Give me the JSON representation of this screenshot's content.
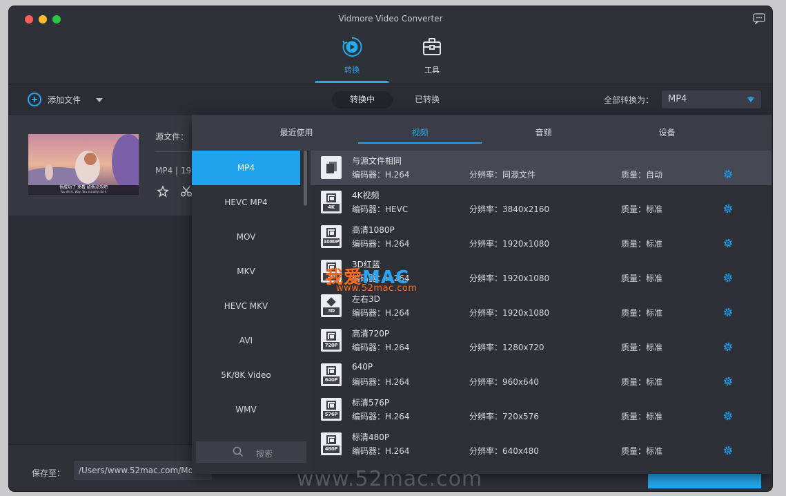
{
  "window": {
    "title": "Vidmore Video Converter"
  },
  "nav": {
    "convert_label": "转换",
    "tools_label": "工具"
  },
  "toolbar": {
    "add_file_label": "添加文件",
    "segment_converting": "转换中",
    "segment_converted": "已转换",
    "convert_all_label": "全部转换为：",
    "convert_all_value": "MP4"
  },
  "file": {
    "source_label": "源文件：",
    "meta_text": "MP4 | 19",
    "subtitle_line1": "他成功了 来看 给他点乐吧",
    "subtitle_line2": "You did it. Way. You actually did it"
  },
  "bottom": {
    "save_label": "保存至：",
    "save_path": "/Users/www.52mac.com/Mo"
  },
  "popup": {
    "tabs": [
      {
        "label": "最近使用",
        "active": false
      },
      {
        "label": "视频",
        "active": true
      },
      {
        "label": "音频",
        "active": false
      },
      {
        "label": "设备",
        "active": false
      }
    ],
    "formats": [
      {
        "label": "MP4",
        "active": true
      },
      {
        "label": "HEVC MP4",
        "active": false
      },
      {
        "label": "MOV",
        "active": false
      },
      {
        "label": "MKV",
        "active": false
      },
      {
        "label": "HEVC MKV",
        "active": false
      },
      {
        "label": "AVI",
        "active": false
      },
      {
        "label": "5K/8K Video",
        "active": false
      },
      {
        "label": "WMV",
        "active": false
      }
    ],
    "search_placeholder": "搜索",
    "presets": [
      {
        "name": "与源文件相同",
        "encoder": "编码器：H.264",
        "resolution": "分辨率：同源文件",
        "quality": "质量：自动",
        "icon": "same",
        "tag": "",
        "active": true
      },
      {
        "name": "4K视频",
        "encoder": "编码器：HEVC",
        "resolution": "分辨率：3840x2160",
        "quality": "质量：标准",
        "icon": "film",
        "tag": "4K",
        "active": false
      },
      {
        "name": "高清1080P",
        "encoder": "编码器：H.264",
        "resolution": "分辨率：1920x1080",
        "quality": "质量：标准",
        "icon": "film",
        "tag": "1080P",
        "active": false
      },
      {
        "name": "3D红蓝",
        "encoder": "编码器：H.264",
        "resolution": "分辨率：1920x1080",
        "quality": "质量：标准",
        "icon": "film",
        "tag": "3D",
        "active": false
      },
      {
        "name": "左右3D",
        "encoder": "编码器：H.264",
        "resolution": "分辨率：1920x1080",
        "quality": "质量：标准",
        "icon": "cube",
        "tag": "3D",
        "active": false
      },
      {
        "name": "高清720P",
        "encoder": "编码器：H.264",
        "resolution": "分辨率：1280x720",
        "quality": "质量：标准",
        "icon": "film",
        "tag": "720P",
        "active": false
      },
      {
        "name": "640P",
        "encoder": "编码器：H.264",
        "resolution": "分辨率：960x640",
        "quality": "质量：标准",
        "icon": "film",
        "tag": "640P",
        "active": false
      },
      {
        "name": "标清576P",
        "encoder": "编码器：H.264",
        "resolution": "分辨率：720x576",
        "quality": "质量：标准",
        "icon": "film",
        "tag": "576P",
        "active": false
      },
      {
        "name": "标清480P",
        "encoder": "编码器：H.264",
        "resolution": "分辨率：640x480",
        "quality": "质量：标准",
        "icon": "film",
        "tag": "480P",
        "active": false
      }
    ]
  },
  "watermark": {
    "logo_part1": "我爱",
    "logo_part2": "MAC",
    "url": "www.52mac.com",
    "bottom_text": "www.52mac.com"
  },
  "colors": {
    "accent": "#25a9ef",
    "background": "#2b2d35",
    "popup": "#3a3d46"
  }
}
